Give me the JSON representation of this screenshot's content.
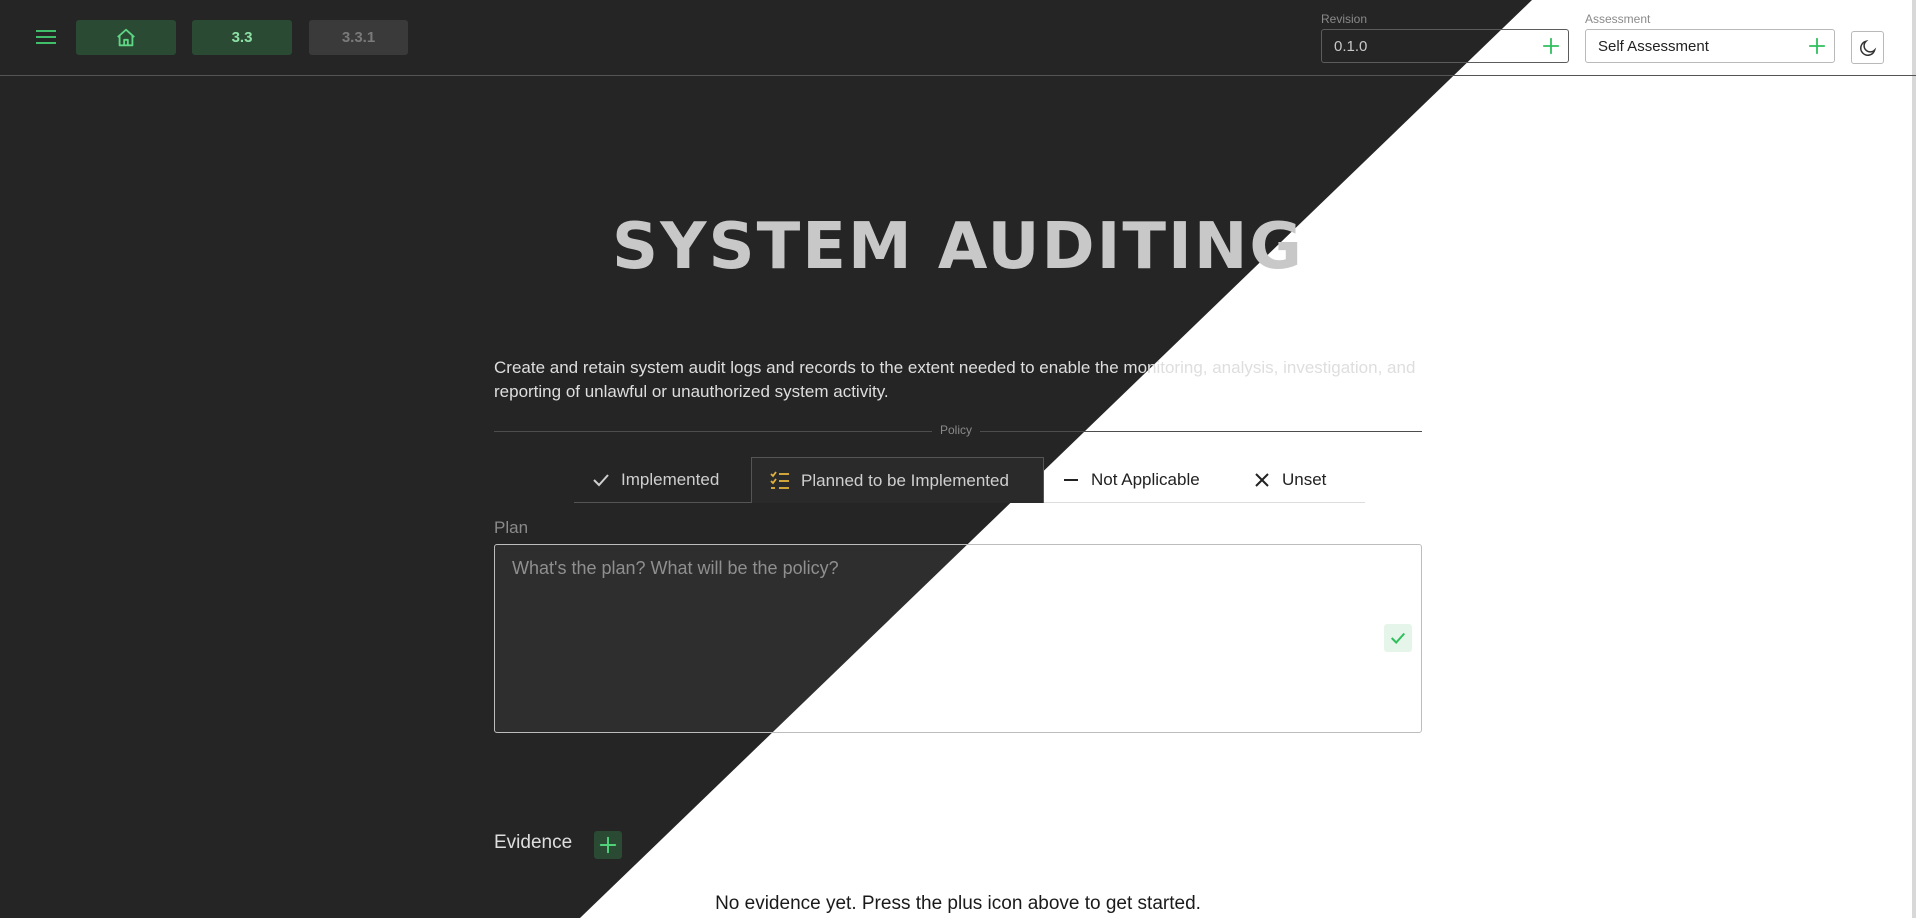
{
  "header": {
    "breadcrumbs": [
      {
        "icon": "home-icon",
        "label": ""
      },
      {
        "label": "3.3"
      },
      {
        "label": "3.3.1"
      }
    ],
    "revision": {
      "label": "Revision",
      "value": "0.1.0"
    },
    "assessment": {
      "label": "Assessment",
      "value": "Self Assessment"
    }
  },
  "page": {
    "title": "SYSTEM AUDITING",
    "description": "Create and retain system audit logs and records to the extent needed to enable the monitoring, analysis, investigation, and reporting of unlawful or unauthorized system activity."
  },
  "policy": {
    "section_label": "Policy",
    "tabs": [
      {
        "label": "Implemented",
        "icon": "check-icon",
        "selected": false
      },
      {
        "label": "Planned to be Implemented",
        "icon": "checklist-icon",
        "selected": true
      },
      {
        "label": "Not Applicable",
        "icon": "minus-icon",
        "selected": false
      },
      {
        "label": "Unset",
        "icon": "x-icon",
        "selected": false
      }
    ]
  },
  "plan": {
    "label": "Plan",
    "placeholder": "What's the plan? What will be the policy?",
    "value": ""
  },
  "evidence": {
    "label": "Evidence",
    "empty_message": "No evidence yet. Press the plus icon above to get started."
  },
  "colors": {
    "accent": "#3fbf6a",
    "dark_bg": "#252525",
    "light_bg": "#ffffff",
    "selected_tab_icon": "#e2b33c"
  }
}
